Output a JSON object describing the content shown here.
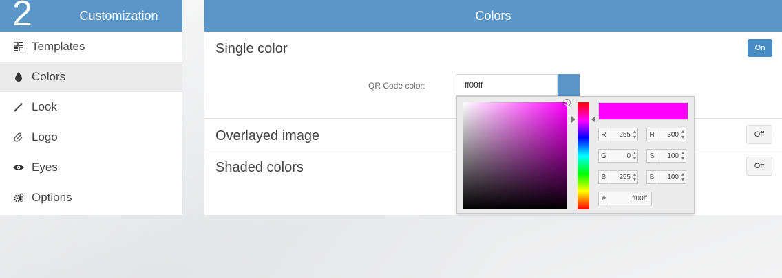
{
  "sidebar": {
    "step_number": "2",
    "title": "Customization",
    "items": [
      {
        "label": "Templates",
        "icon": "templates-grid-icon"
      },
      {
        "label": "Colors",
        "icon": "droplet-icon"
      },
      {
        "label": "Look",
        "icon": "magic-wand-icon"
      },
      {
        "label": "Logo",
        "icon": "paperclip-icon"
      },
      {
        "label": "Eyes",
        "icon": "eye-icon"
      },
      {
        "label": "Options",
        "icon": "gears-icon"
      }
    ],
    "active_item": "Colors"
  },
  "main": {
    "title": "Colors",
    "sections": {
      "single_color": {
        "title": "Single color",
        "toggle": "On"
      },
      "overlayed_image": {
        "title": "Overlayed image",
        "toggle": "Off"
      },
      "shaded_colors": {
        "title": "Shaded colors",
        "toggle": "Off"
      }
    },
    "qr_color": {
      "label": "QR Code color:",
      "value": "ff00ff"
    }
  },
  "picker": {
    "r": "255",
    "g": "0",
    "b": "255",
    "h": "300",
    "s": "100",
    "v": "100",
    "hex": "ff00ff",
    "labels": {
      "r": "R",
      "g": "G",
      "b": "B",
      "h": "H",
      "s": "S",
      "v": "B",
      "hex": "#"
    }
  },
  "colors": {
    "accent": "#5a96c8",
    "toggle_on": "#4a8cc4",
    "selected_color": "#ff00ff"
  }
}
